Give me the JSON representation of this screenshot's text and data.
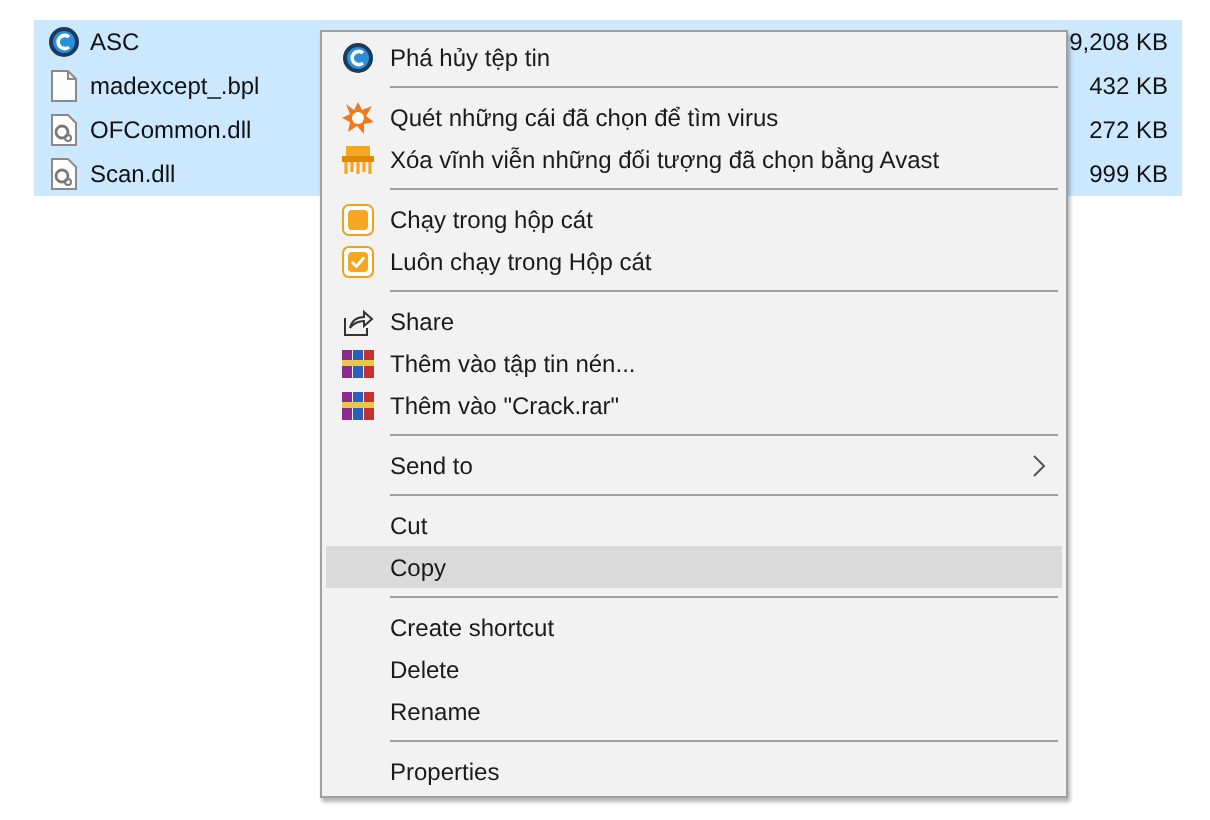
{
  "files": [
    {
      "name": "ASC",
      "size": "9,208 KB",
      "kind": "app",
      "selected": true
    },
    {
      "name": "madexcept_.bpl",
      "size": "432 KB",
      "kind": "blank",
      "selected": true
    },
    {
      "name": "OFCommon.dll",
      "size": "272 KB",
      "kind": "dll",
      "selected": true
    },
    {
      "name": "Scan.dll",
      "size": "999 KB",
      "kind": "dll",
      "selected": true
    }
  ],
  "context_menu": {
    "groups": [
      [
        {
          "label": "Phá hủy tệp tin",
          "kind": "app",
          "selected": false
        }
      ],
      [
        {
          "label": "Quét những cái đã chọn để tìm virus",
          "kind": "scan",
          "selected": false
        },
        {
          "label": "Xóa vĩnh viễn những đối tượng đã chọn bằng Avast",
          "kind": "shred",
          "selected": false
        }
      ],
      [
        {
          "label": "Chạy trong hộp cát",
          "kind": "sandbox",
          "selected": false
        },
        {
          "label": "Luôn chạy trong Hộp cát",
          "kind": "sandbox-check",
          "selected": false
        }
      ],
      [
        {
          "label": "Share",
          "kind": "share",
          "selected": false
        },
        {
          "label": "Thêm vào tập tin nén...",
          "kind": "archive",
          "selected": false
        },
        {
          "label": "Thêm vào \"Crack.rar\"",
          "kind": "archive",
          "selected": false
        }
      ],
      [
        {
          "label": "Send to",
          "kind": "submenu",
          "selected": false
        }
      ],
      [
        {
          "label": "Cut",
          "kind": "plain",
          "selected": false
        },
        {
          "label": "Copy",
          "kind": "plain",
          "selected": true
        }
      ],
      [
        {
          "label": "Create shortcut",
          "kind": "plain",
          "selected": false
        },
        {
          "label": "Delete",
          "kind": "plain",
          "selected": false
        },
        {
          "label": "Rename",
          "kind": "plain",
          "selected": false
        }
      ],
      [
        {
          "label": "Properties",
          "kind": "plain",
          "selected": false
        }
      ]
    ]
  }
}
